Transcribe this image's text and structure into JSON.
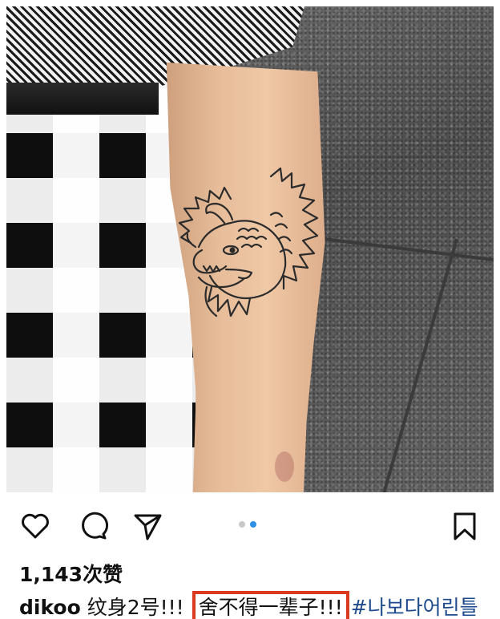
{
  "post": {
    "likes": "1,143次赞",
    "caption": {
      "username": "dikoo",
      "text_before": " 纹身2号!!! ",
      "highlighted": "舍不得一辈子!!!",
      "hashtag": "#나보다어린틀"
    },
    "carousel": {
      "total": 2,
      "active_index": 1
    }
  },
  "icons": {
    "like": "heart-icon",
    "comment": "comment-bubble-icon",
    "share": "paper-plane-icon",
    "save": "bookmark-icon"
  },
  "colors": {
    "highlight_border": "#d93a1f",
    "hashtag": "#1c4a8c",
    "dot_active": "#2f8fe6",
    "dot_inactive": "#c8c8c8"
  }
}
